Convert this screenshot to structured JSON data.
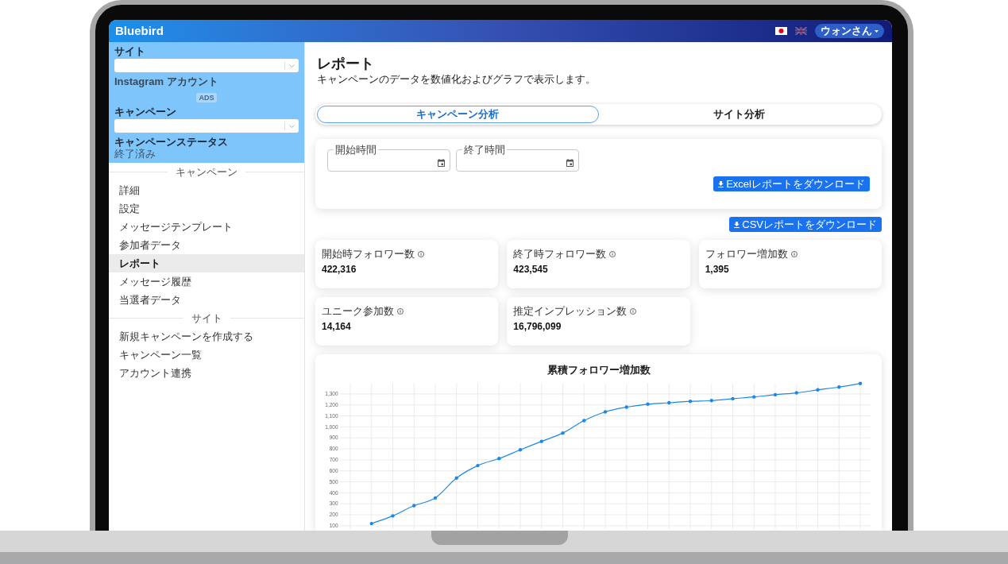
{
  "header": {
    "logo": "Bluebird",
    "languages": [
      {
        "kind": "jp",
        "selected": true
      },
      {
        "kind": "gb",
        "selected": false
      }
    ],
    "user_menu": {
      "label": "ウォンさん"
    }
  },
  "sidebar": {
    "filters": [
      {
        "kind": "select",
        "label": "サイト"
      },
      {
        "kind": "account",
        "label": "Instagram アカウント",
        "badge": "ADS"
      },
      {
        "kind": "select",
        "label": "キャンペーン"
      },
      {
        "kind": "status",
        "label": "キャンペーンステータス",
        "value": "終了済み"
      }
    ],
    "sections": [
      {
        "title": "キャンペーン",
        "items": [
          {
            "label": "詳細",
            "selected": false
          },
          {
            "label": "設定",
            "selected": false
          },
          {
            "label": "メッセージテンプレート",
            "selected": false
          },
          {
            "label": "参加者データ",
            "selected": false
          },
          {
            "label": "レポート",
            "selected": true
          },
          {
            "label": "メッセージ履歴",
            "selected": false
          },
          {
            "label": "当選者データ",
            "selected": false
          }
        ]
      },
      {
        "title": "サイト",
        "items": [
          {
            "label": "新規キャンペーンを作成する",
            "selected": false
          },
          {
            "label": "キャンペーン一覧",
            "selected": false
          },
          {
            "label": "アカウント連携",
            "selected": false
          }
        ]
      }
    ]
  },
  "page": {
    "title": "レポート",
    "subtitle": "キャンペーンのデータを数値化およびグラフで表示します。"
  },
  "tabs": [
    {
      "label": "キャンペーン分析",
      "selected": true
    },
    {
      "label": "サイト分析",
      "selected": false
    }
  ],
  "filters": {
    "date_fields": [
      {
        "label": "開始時間"
      },
      {
        "label": "終了時間"
      }
    ],
    "excel_button": "Excelレポートをダウンロード"
  },
  "csv_button": "CSVレポートをダウンロード",
  "stats": [
    {
      "label": "開始時フォロワー数",
      "value": "422,316"
    },
    {
      "label": "終了時フォロワー数",
      "value": "423,545"
    },
    {
      "label": "フォロワー増加数",
      "value": "1,395"
    },
    {
      "label": "ユニーク参加数",
      "value": "14,164"
    },
    {
      "label": "推定インプレッション数",
      "value": "16,796,099"
    }
  ],
  "chart": {
    "chart_data": {
      "type": "line",
      "title": "累積フォロワー増加数",
      "grid": true,
      "series": [
        {
          "color": "#1e88e5",
          "values": [
            null,
            120,
            190,
            283,
            353,
            535,
            648,
            712,
            791,
            868,
            944,
            1057,
            1137,
            1180,
            1207,
            1220,
            1233,
            1240,
            1257,
            1273,
            1293,
            1310,
            1337,
            1363,
            1395
          ]
        }
      ],
      "ylim": [
        70,
        1395
      ],
      "yticks": [
        100,
        200,
        300,
        400,
        500,
        600,
        700,
        800,
        900,
        {
          "value": 1000,
          "label": "1,000"
        },
        {
          "value": 1100,
          "label": "1,100"
        },
        {
          "value": 1200,
          "label": "1,200"
        },
        {
          "value": 1300,
          "label": "1,300"
        }
      ]
    }
  }
}
